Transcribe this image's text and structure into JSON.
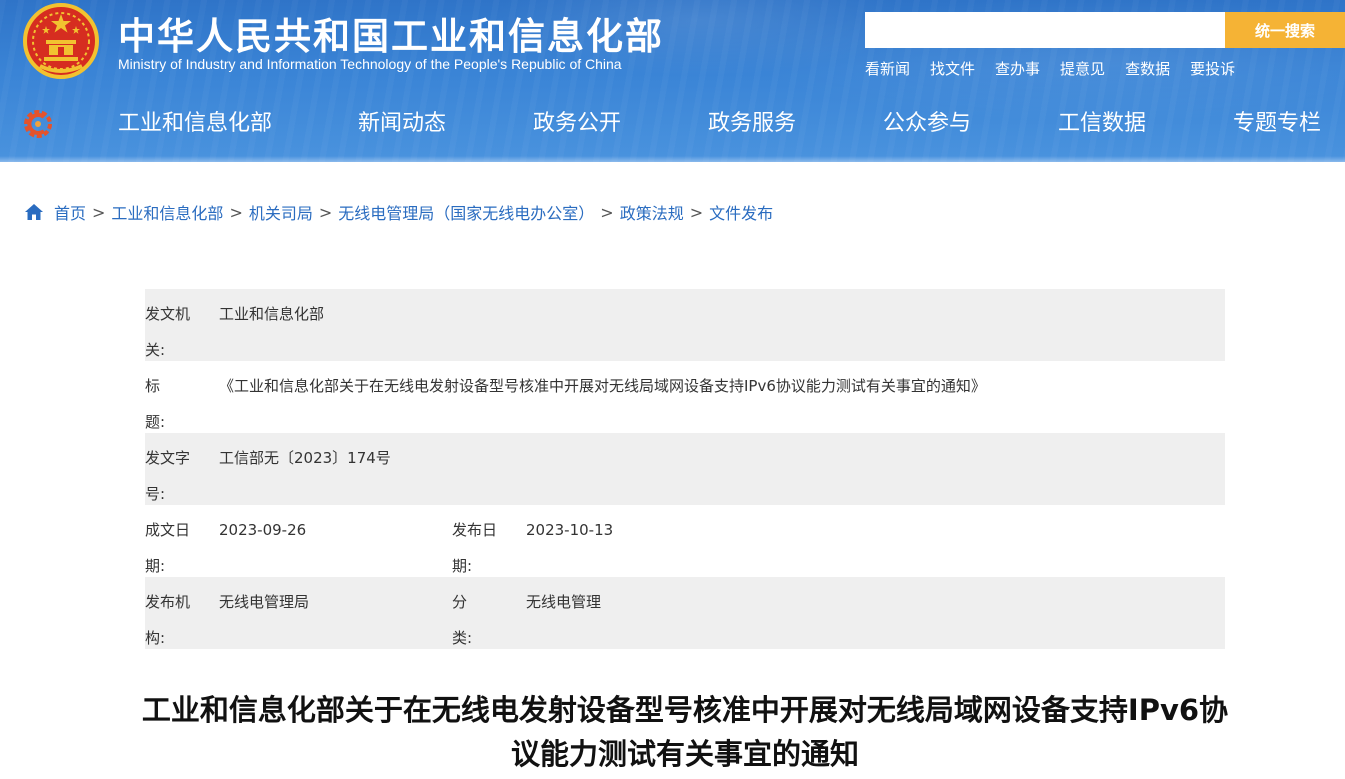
{
  "header": {
    "site_title": "中华人民共和国工业和信息化部",
    "site_subtitle": "Ministry of Industry and Information Technology of the People's Republic of China",
    "search": {
      "placeholder": "",
      "button_label": "统一搜索"
    },
    "quick_links": [
      "看新闻",
      "找文件",
      "查办事",
      "提意见",
      "查数据",
      "要投诉"
    ],
    "colors": {
      "header_blue": "#3a84d6",
      "search_button": "#f5b335"
    }
  },
  "nav": {
    "items": [
      "工业和信息化部",
      "新闻动态",
      "政务公开",
      "政务服务",
      "公众参与",
      "工信数据",
      "专题专栏"
    ]
  },
  "breadcrumb": {
    "items": [
      "首页",
      "工业和信息化部",
      "机关司局",
      "无线电管理局（国家无线电办公室）",
      "政策法规",
      "文件发布"
    ],
    "separator": ">"
  },
  "meta": {
    "issuer_label": "发文机关:",
    "issuer": "工业和信息化部",
    "title_label": "标题:",
    "title": "《工业和信息化部关于在无线电发射设备型号核准中开展对无线局域网设备支持IPv6协议能力测试有关事宜的通知》",
    "doc_number_label": "发文字号:",
    "doc_number": "工信部无〔2023〕174号",
    "written_date_label": "成文日期:",
    "written_date": "2023-09-26",
    "publish_date_label": "发布日期:",
    "publish_date": "2023-10-13",
    "publisher_label": "发布机构:",
    "publisher": "无线电管理局",
    "category_label": "分类:",
    "category": "无线电管理"
  },
  "article": {
    "title": "工业和信息化部关于在无线电发射设备型号核准中开展对无线局域网设备支持IPv6协议能力测试有关事宜的通知"
  }
}
